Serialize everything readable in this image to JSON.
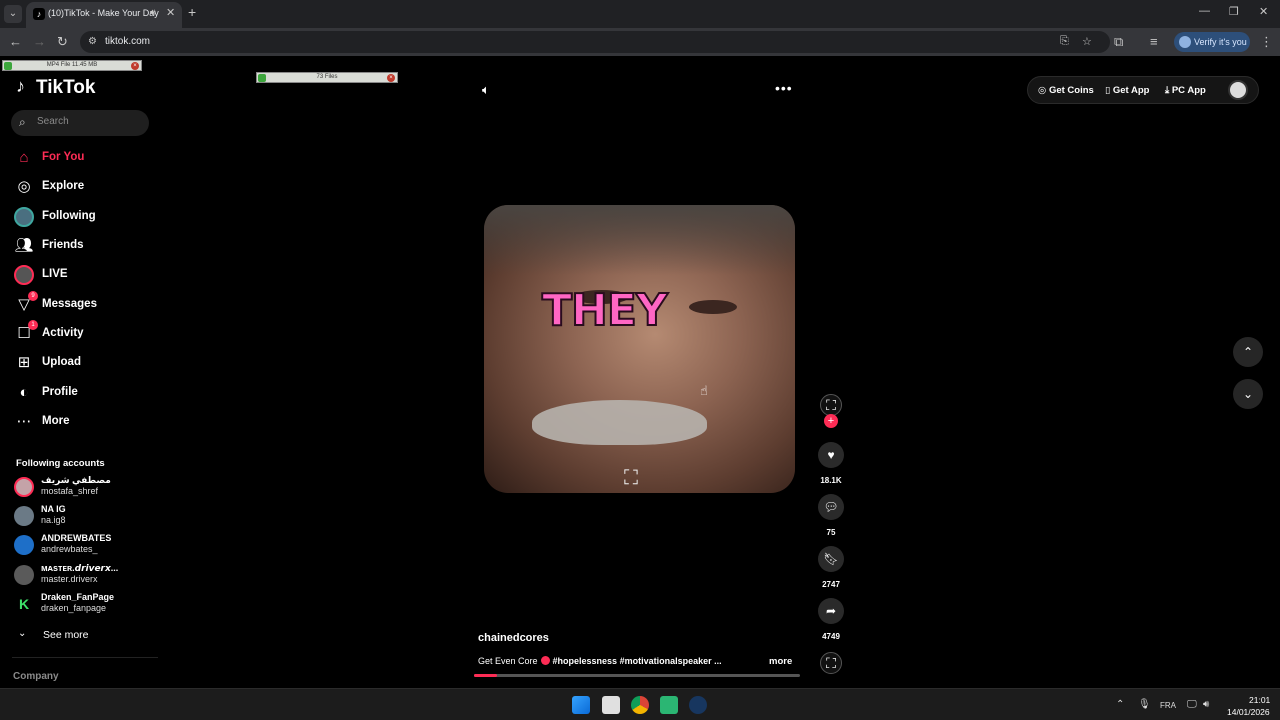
{
  "browser": {
    "tab_title": "(10)TikTok - Make Your Day",
    "url": "tiktok.com",
    "verify_label": "Verify it's you",
    "icons": [
      "tab-search-icon",
      "audio-icon",
      "close-icon",
      "plus-icon",
      "back-icon",
      "forward-icon",
      "reload-icon",
      "site-info-icon",
      "install-icon",
      "star-icon",
      "extensions-icon",
      "reading-list-icon",
      "kebab-icon",
      "minimize-icon",
      "restore-icon",
      "close-window-icon"
    ]
  },
  "overlays": {
    "download_label": "MP4 File 11.45 MB",
    "files_label": "73 Files"
  },
  "sidebar": {
    "logo": "TikTok",
    "search_placeholder": "Search",
    "items": [
      {
        "label": "For You",
        "icon": "home-icon",
        "active": true
      },
      {
        "label": "Explore",
        "icon": "compass-icon"
      },
      {
        "label": "Following",
        "icon": "avatar-icon"
      },
      {
        "label": "Friends",
        "icon": "friends-icon"
      },
      {
        "label": "LIVE",
        "icon": "live-avatar-icon"
      },
      {
        "label": "Messages",
        "icon": "messages-icon",
        "badge": "9"
      },
      {
        "label": "Activity",
        "icon": "activity-icon",
        "badge": "1"
      },
      {
        "label": "Upload",
        "icon": "upload-icon"
      },
      {
        "label": "Profile",
        "icon": "profile-icon"
      },
      {
        "label": "More",
        "icon": "more-icon"
      }
    ],
    "following_title": "Following accounts",
    "accounts": [
      {
        "name": "مصطفي شريف",
        "handle": "mostafa_shref"
      },
      {
        "name": "NA IG",
        "handle": "na.ig8"
      },
      {
        "name": "ANDREWBATES",
        "handle": "andrewbates_"
      },
      {
        "name": "ᴍᴀsᴛᴇʀ.𝙙𝙧𝙞𝙫𝙚𝙧𝙭...",
        "handle": "master.driverx"
      },
      {
        "name": "Draken_FanPage",
        "handle": "draken_fanpage"
      }
    ],
    "see_more": "See more",
    "company": "Company"
  },
  "header": {
    "get_coins": "Get Coins",
    "get_app": "Get App",
    "pc_app": "PC App"
  },
  "video": {
    "caption_word": "THEY",
    "author": "chainedcores",
    "description_prefix": "Get Even Core",
    "hashtags": "#hopelessness #motivationalspeaker ...",
    "more_label": "more",
    "progress_fraction": 0.07,
    "likes": "18.1K",
    "comments": "75",
    "saves": "2747",
    "shares": "4749"
  },
  "taskbar": {
    "language": "FRA",
    "time": "21:01",
    "date": "14/01/2026",
    "apps": [
      "windows-start-icon",
      "file-explorer-icon",
      "chrome-icon",
      "android-studio-icon",
      "steam-icon"
    ]
  },
  "colors": {
    "accent": "#fe2c55",
    "caption": "#ff66c4"
  }
}
